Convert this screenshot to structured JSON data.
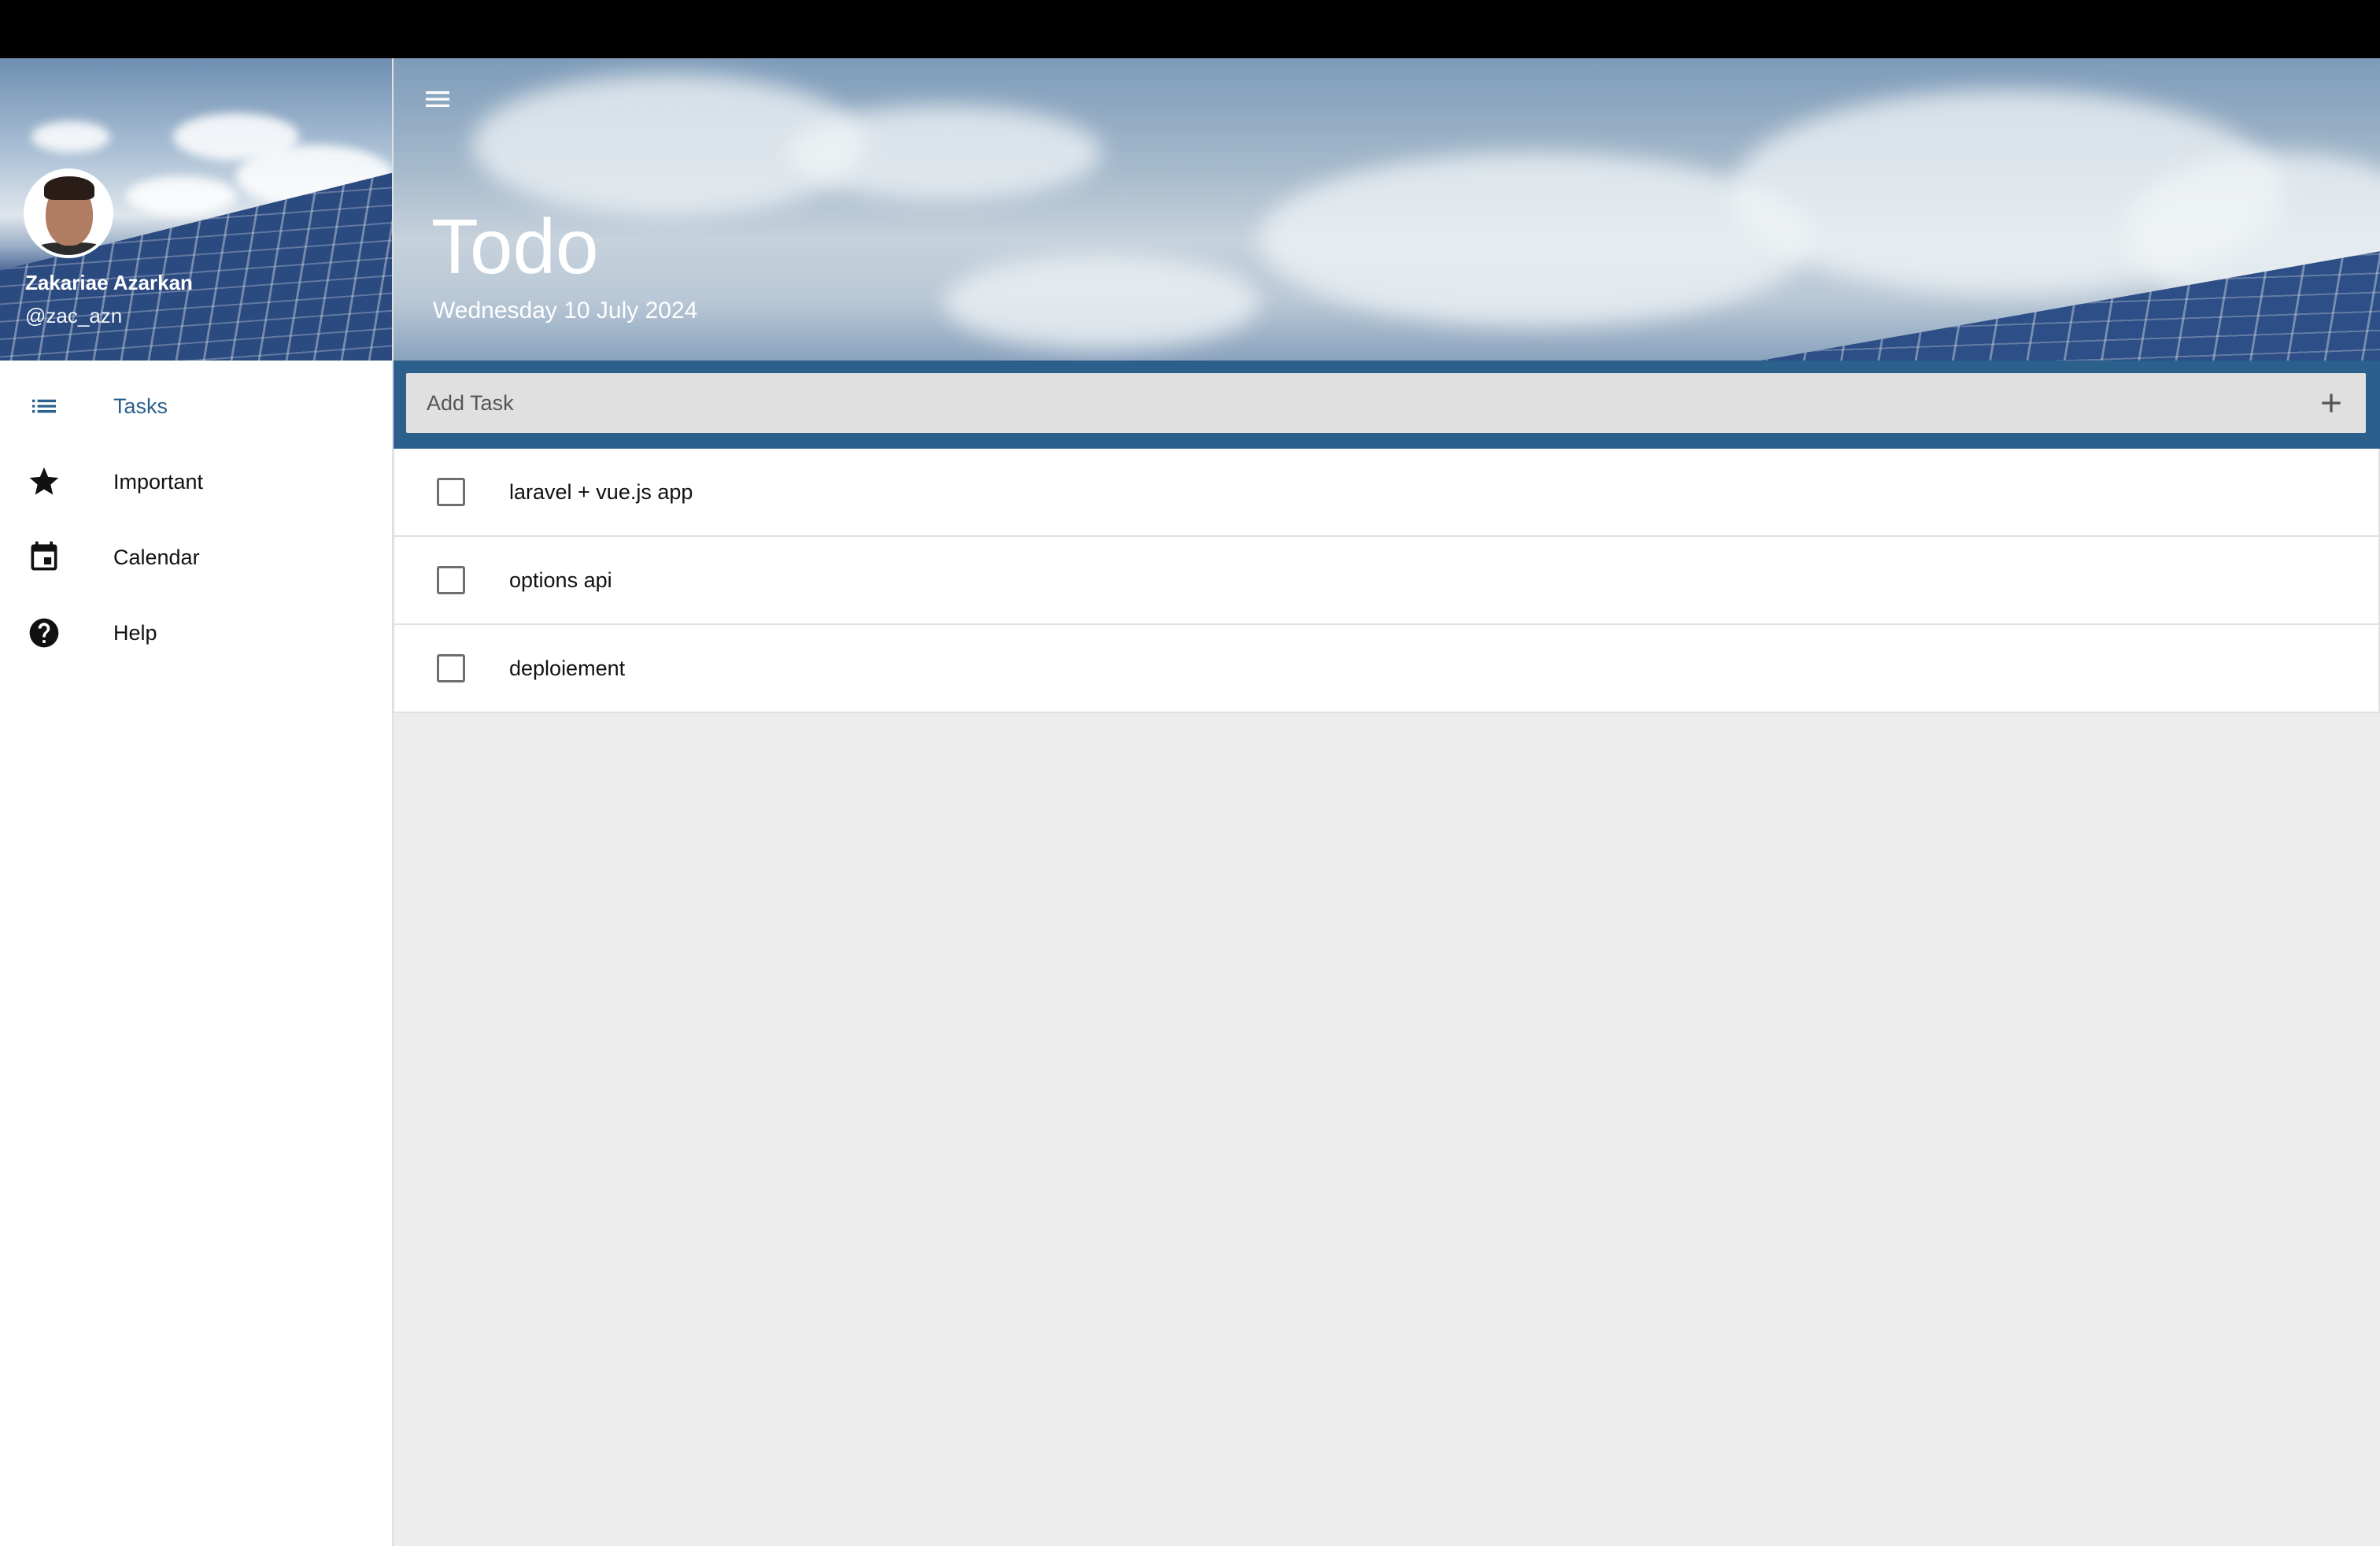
{
  "user": {
    "name": "Zakariae Azarkan",
    "handle": "@zac_azn"
  },
  "nav": {
    "items": [
      {
        "label": "Tasks",
        "icon": "list-icon",
        "active": true
      },
      {
        "label": "Important",
        "icon": "star-icon",
        "active": false
      },
      {
        "label": "Calendar",
        "icon": "calendar-icon",
        "active": false
      },
      {
        "label": "Help",
        "icon": "help-circle-icon",
        "active": false
      }
    ]
  },
  "header": {
    "title": "Todo",
    "date": "Wednesday 10 July 2024"
  },
  "add_task": {
    "placeholder": "Add Task",
    "value": ""
  },
  "tasks": [
    {
      "text": "laravel + vue.js app",
      "done": false
    },
    {
      "text": "options api",
      "done": false
    },
    {
      "text": "deploiement",
      "done": false
    }
  ],
  "colors": {
    "accent": "#2b5f8c",
    "background": "#ededed"
  }
}
